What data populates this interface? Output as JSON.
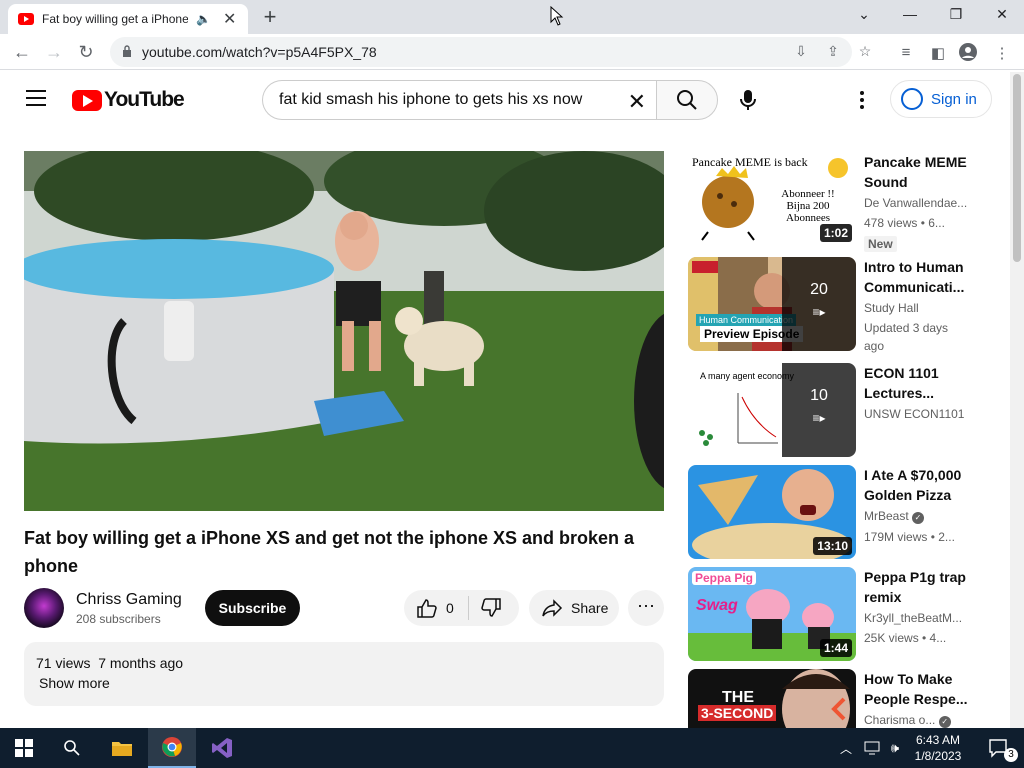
{
  "browser": {
    "tab_title": "Fat boy willing get a iPhone XS",
    "url": "youtube.com/watch?v=p5A4F5PX_78"
  },
  "youtube": {
    "logo_text": "YouTube",
    "search_query": "fat kid smash his iphone to gets his xs now",
    "sign_in": "Sign in"
  },
  "video": {
    "title": "Fat boy willing get a iPhone XS and get not the iphone XS and broken a phone",
    "channel": "Chriss Gaming",
    "subscribers": "208 subscribers",
    "subscribe_label": "Subscribe",
    "likes": "0",
    "share_label": "Share",
    "views": "71 views",
    "age": "7 months ago",
    "show_more": "Show more"
  },
  "sidebar": [
    {
      "title": "Pancake MEME Sound effects...",
      "channel": "De Vanwallendae...",
      "meta": "478 views • 6...",
      "duration": "1:02",
      "badge": "New",
      "thumb_text": "Pancake MEME is back",
      "thumb_sub": "Abonneer !! Bijna 200 Abonnees"
    },
    {
      "title": "Intro to Human Communicati...",
      "channel": "Study Hall",
      "meta": "Updated 3 days ago",
      "count": "20",
      "thumb_text": "Human Communication",
      "thumb_sub": "Preview Episode"
    },
    {
      "title": "ECON 1101 Lectures...",
      "channel": "UNSW ECON1101",
      "meta": "",
      "count": "10",
      "thumb_text": "A many agent economy"
    },
    {
      "title": "I Ate A $70,000 Golden Pizza",
      "channel": "MrBeast",
      "meta": "179M views • 2...",
      "duration": "13:10"
    },
    {
      "title": "Peppa P1g trap remix",
      "channel": "Kr3yll_theBeatM...",
      "meta": "25K views • 4...",
      "duration": "1:44",
      "thumb_text": "Peppa Pig",
      "thumb_sub": "Swag"
    },
    {
      "title": "How To Make People Respe...",
      "channel": "Charisma o...",
      "meta": "",
      "thumb_text": "THE",
      "thumb_sub": "3-SECOND"
    }
  ],
  "taskbar": {
    "time": "6:43 AM",
    "date": "1/8/2023",
    "notifications": "3"
  }
}
